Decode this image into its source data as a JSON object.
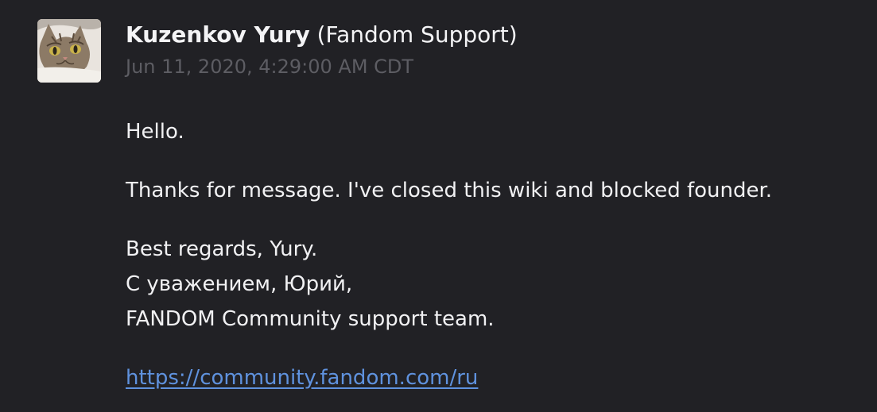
{
  "message": {
    "author_name": "Kuzenkov Yury",
    "author_affiliation": "(Fandom Support)",
    "timestamp": "Jun 11, 2020, 4:29:00 AM CDT",
    "avatar_icon": "cat-photo-avatar",
    "greeting": "Hello.",
    "body_line": "Thanks for message. I've closed this wiki and blocked founder.",
    "signature": [
      "Best regards, Yury.",
      "С уважением, Юрий,",
      "FANDOM Community support team."
    ],
    "link_text": "https://community.fandom.com/ru"
  },
  "colors": {
    "background": "#212125",
    "text": "#f1f1f3",
    "timestamp": "#5d5d63",
    "link": "#5f92de"
  }
}
